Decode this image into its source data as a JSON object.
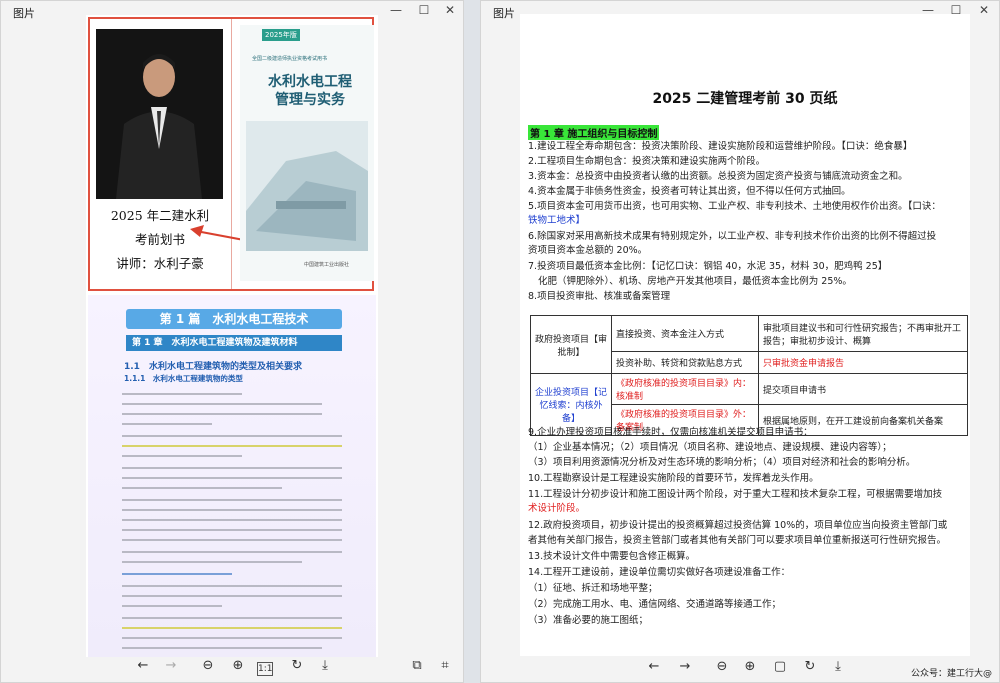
{
  "left_window": {
    "title": "图片",
    "controls": {
      "minimize": "—",
      "maximize": "☐",
      "close": "✕"
    },
    "promo": {
      "title": "2025 年二建水利",
      "subtitle": "考前划书",
      "teacher": "讲师：水利子豪"
    },
    "cover": {
      "badge": "2025年版",
      "year": "2025年版",
      "series": "全国二级建造师执业资格考试用书",
      "title_line1": "水利水电工程",
      "title_line2": "管理与实务",
      "publisher": "中国建筑工业出版社"
    },
    "book": {
      "part": "第 1 篇　水利水电工程技术",
      "chapter": "第 1 章　水利水电工程建筑物及建筑材料",
      "section": "1.1　水利水电工程建筑物的类型及相关要求",
      "subsection": "1.1.1　水利水电工程建筑物的类型"
    },
    "toolbar": {
      "prev": "←",
      "next": "→",
      "zoom_out": "⊖",
      "zoom_in": "⊕",
      "fit": "1:1",
      "rotate": "↻",
      "download": "⤓",
      "share": "⧉",
      "scan": "⌗"
    }
  },
  "right_window": {
    "title": "图片",
    "controls": {
      "minimize": "—",
      "maximize": "☐",
      "close": "✕"
    },
    "doc": {
      "title": "2025 二建管理考前 30 页纸",
      "chapter": "第 1 章 施工组织与目标控制",
      "items": [
        "1.建设工程全寿命期包含：投资决策阶段、建设实施阶段和运营维护阶段。【口诀：绝食暴】",
        "2.工程项目生命期包含：投资决策和建设实施两个阶段。",
        "3.资本金：总投资中由投资者认缴的出资额。总投资为固定资产投资与铺底流动资金之和。",
        "4.资本金属于非债务性资金，投资者可转让其出资，但不得以任何方式抽回。",
        "5.项目资本金可用货币出资，也可用实物、工业产权、非专利技术、土地使用权作价出资。【口诀：",
        "铁物工地术】",
        "6.除国家对采用高新技术成果有特别规定外，以工业产权、非专利技术作价出资的比例不得超过投",
        "资项目资本金总额的 20%。",
        "7.投资项目最低资本金比例：【记忆口诀：钢铝 40，水泥 35，材料 30，肥鸡鸭 25】",
        "化肥（钾肥除外）、机场、房地产开发其他项目，最低资本金比例为 25%。",
        "8.项目投资审批、核准或备案管理"
      ],
      "table": {
        "row1_c1": "政府投资项目【审批制】",
        "row1_c2": "直接投资、资本金注入方式",
        "row1_c3": "审批项目建议书和可行性研究报告；不再审批开工报告；审批初步设计、概算",
        "row2_c2": "投资补助、转贷和贷款贴息方式",
        "row2_c3": "只审批资金申请报告",
        "row3_c1": "企业投资项目【记忆线索：内核外备】",
        "row3_c2": "《政府核准的投资项目目录》内：核准制",
        "row3_c3": "提交项目申请书",
        "row4_c2": "《政府核准的投资项目目录》外：备案制",
        "row4_c3": "根据属地原则，在开工建设前向备案机关备案"
      },
      "items2": [
        "9.企业办理投资项目核准手续时，仅需向核准机关提交项目申请书：",
        "（1）企业基本情况；（2）项目情况（项目名称、建设地点、建设规模、建设内容等）；",
        "（3）项目利用资源情况分析及对生态环境的影响分析；（4）项目对经济和社会的影响分析。",
        "10.工程勘察设计是工程建设实施阶段的首要环节，发挥着龙头作用。",
        "11.工程设计分初步设计和施工图设计两个阶段，对于重大工程和技术复杂工程，可根据需要增加技",
        "术设计阶段。",
        "12.政府投资项目，初步设计提出的投资概算超过投资估算 10%的，项目单位应当向投资主管部门或",
        "者其他有关部门报告，投资主管部门或者其他有关部门可以要求项目单位重新报送可行性研究报告。",
        "13.技术设计文件中需要包含修正概算。",
        "14.工程开工建设前，建设单位需切实做好各项建设准备工作：",
        "（1）征地、拆迁和场地平整；",
        "（2）完成施工用水、电、通信网络、交通道路等接通工作；",
        "（3）准备必要的施工图纸；"
      ]
    },
    "toolbar": {
      "prev": "←",
      "next": "→",
      "zoom_out": "⊖",
      "zoom_in": "⊕",
      "fit": "▢",
      "rotate": "↻",
      "download": "⤓"
    },
    "watermark": "公众号：建工行大@"
  },
  "colors": {
    "accent_red": "#e02020",
    "accent_blue": "#2040d0",
    "highlight_green": "#39e639"
  }
}
